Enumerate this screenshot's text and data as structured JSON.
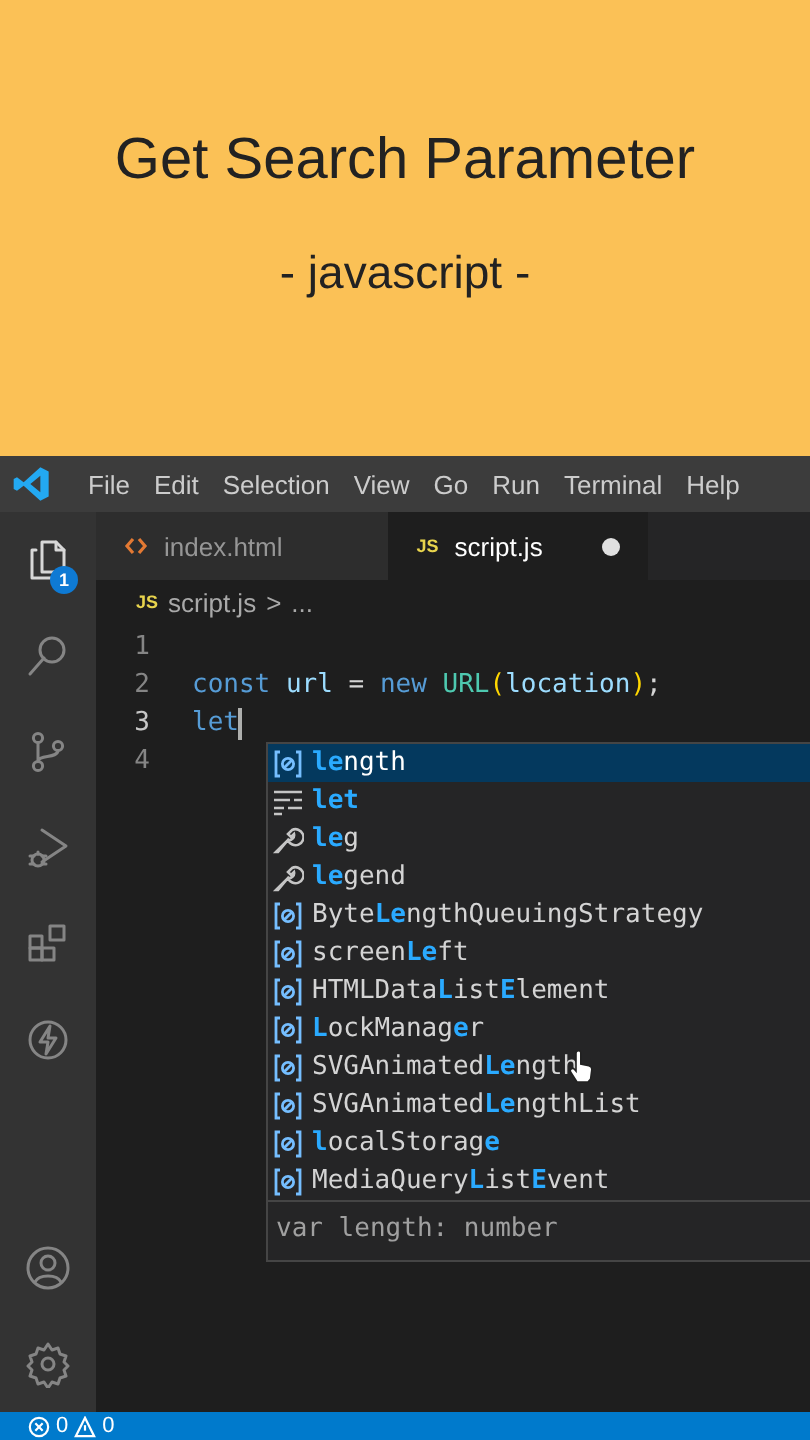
{
  "header": {
    "title": "Get Search Parameter",
    "subtitle": "- javascript -"
  },
  "menu": {
    "items": [
      "File",
      "Edit",
      "Selection",
      "View",
      "Go",
      "Run",
      "Terminal",
      "Help"
    ]
  },
  "activity_bar": {
    "top_items": [
      {
        "kind": "explorer",
        "selected": true,
        "badge": "1"
      },
      {
        "kind": "search",
        "selected": false
      },
      {
        "kind": "source_control",
        "selected": false
      },
      {
        "kind": "run_debug",
        "selected": false
      },
      {
        "kind": "extensions",
        "selected": false
      },
      {
        "kind": "remote",
        "selected": false
      }
    ],
    "bottom_items": [
      {
        "kind": "account",
        "selected": false
      },
      {
        "kind": "settings",
        "selected": false
      }
    ]
  },
  "tabs": [
    {
      "kind": "html",
      "label": "index.html",
      "selected": false,
      "modified": false
    },
    {
      "kind": "js",
      "icon_text": "JS",
      "label": "script.js",
      "selected": true,
      "modified": true
    }
  ],
  "breadcrumb": {
    "icon_text": "JS",
    "file": "script.js",
    "separator": ">",
    "rest": "..."
  },
  "editor": {
    "lines": [
      {
        "number": "1",
        "current": false
      },
      {
        "number": "2",
        "current": false,
        "tokens": [
          {
            "kind": "keyword",
            "text": "const"
          },
          {
            "kind": "variable",
            "text": " url"
          },
          {
            "kind": "plain",
            "text": " = "
          },
          {
            "kind": "keyword",
            "text": "new"
          },
          {
            "kind": "class",
            "text": " URL"
          },
          {
            "kind": "bracket",
            "text": "("
          },
          {
            "kind": "variable",
            "text": "location"
          },
          {
            "kind": "bracket",
            "text": ")"
          },
          {
            "kind": "plain",
            "text": ";"
          }
        ]
      },
      {
        "number": "3",
        "current": true,
        "tokens": [
          {
            "kind": "keyword",
            "text": "let"
          }
        ]
      },
      {
        "number": "4",
        "current": false
      }
    ]
  },
  "suggestions": {
    "items": [
      {
        "kind": "variable",
        "label": "**le**ngth",
        "selected": true
      },
      {
        "kind": "keyword",
        "label": "**let**",
        "selected": false
      },
      {
        "kind": "snippet",
        "label": "**le**g",
        "selected": false
      },
      {
        "kind": "snippet",
        "label": "**le**gend",
        "selected": false
      },
      {
        "kind": "variable",
        "label": "Byte**Le**ngthQueuingStrategy",
        "selected": false
      },
      {
        "kind": "variable",
        "label": "screen**Le**ft",
        "selected": false
      },
      {
        "kind": "variable",
        "label": "HTMLData**L**ist**E**lement",
        "selected": false
      },
      {
        "kind": "variable",
        "label": "**L**ockManag**e**r",
        "selected": false
      },
      {
        "kind": "variable",
        "label": "SVGAnimated**Le**ngth",
        "selected": false
      },
      {
        "kind": "variable",
        "label": "SVGAnimated**Le**ngthList",
        "selected": false
      },
      {
        "kind": "variable",
        "label": "**l**ocalStorag**e**",
        "selected": false
      },
      {
        "kind": "variable",
        "label": "MediaQuery**L**ist**E**vent",
        "selected": false
      }
    ],
    "detail": "var length: number"
  },
  "status_bar": {
    "errors": "0",
    "warnings": "0"
  }
}
